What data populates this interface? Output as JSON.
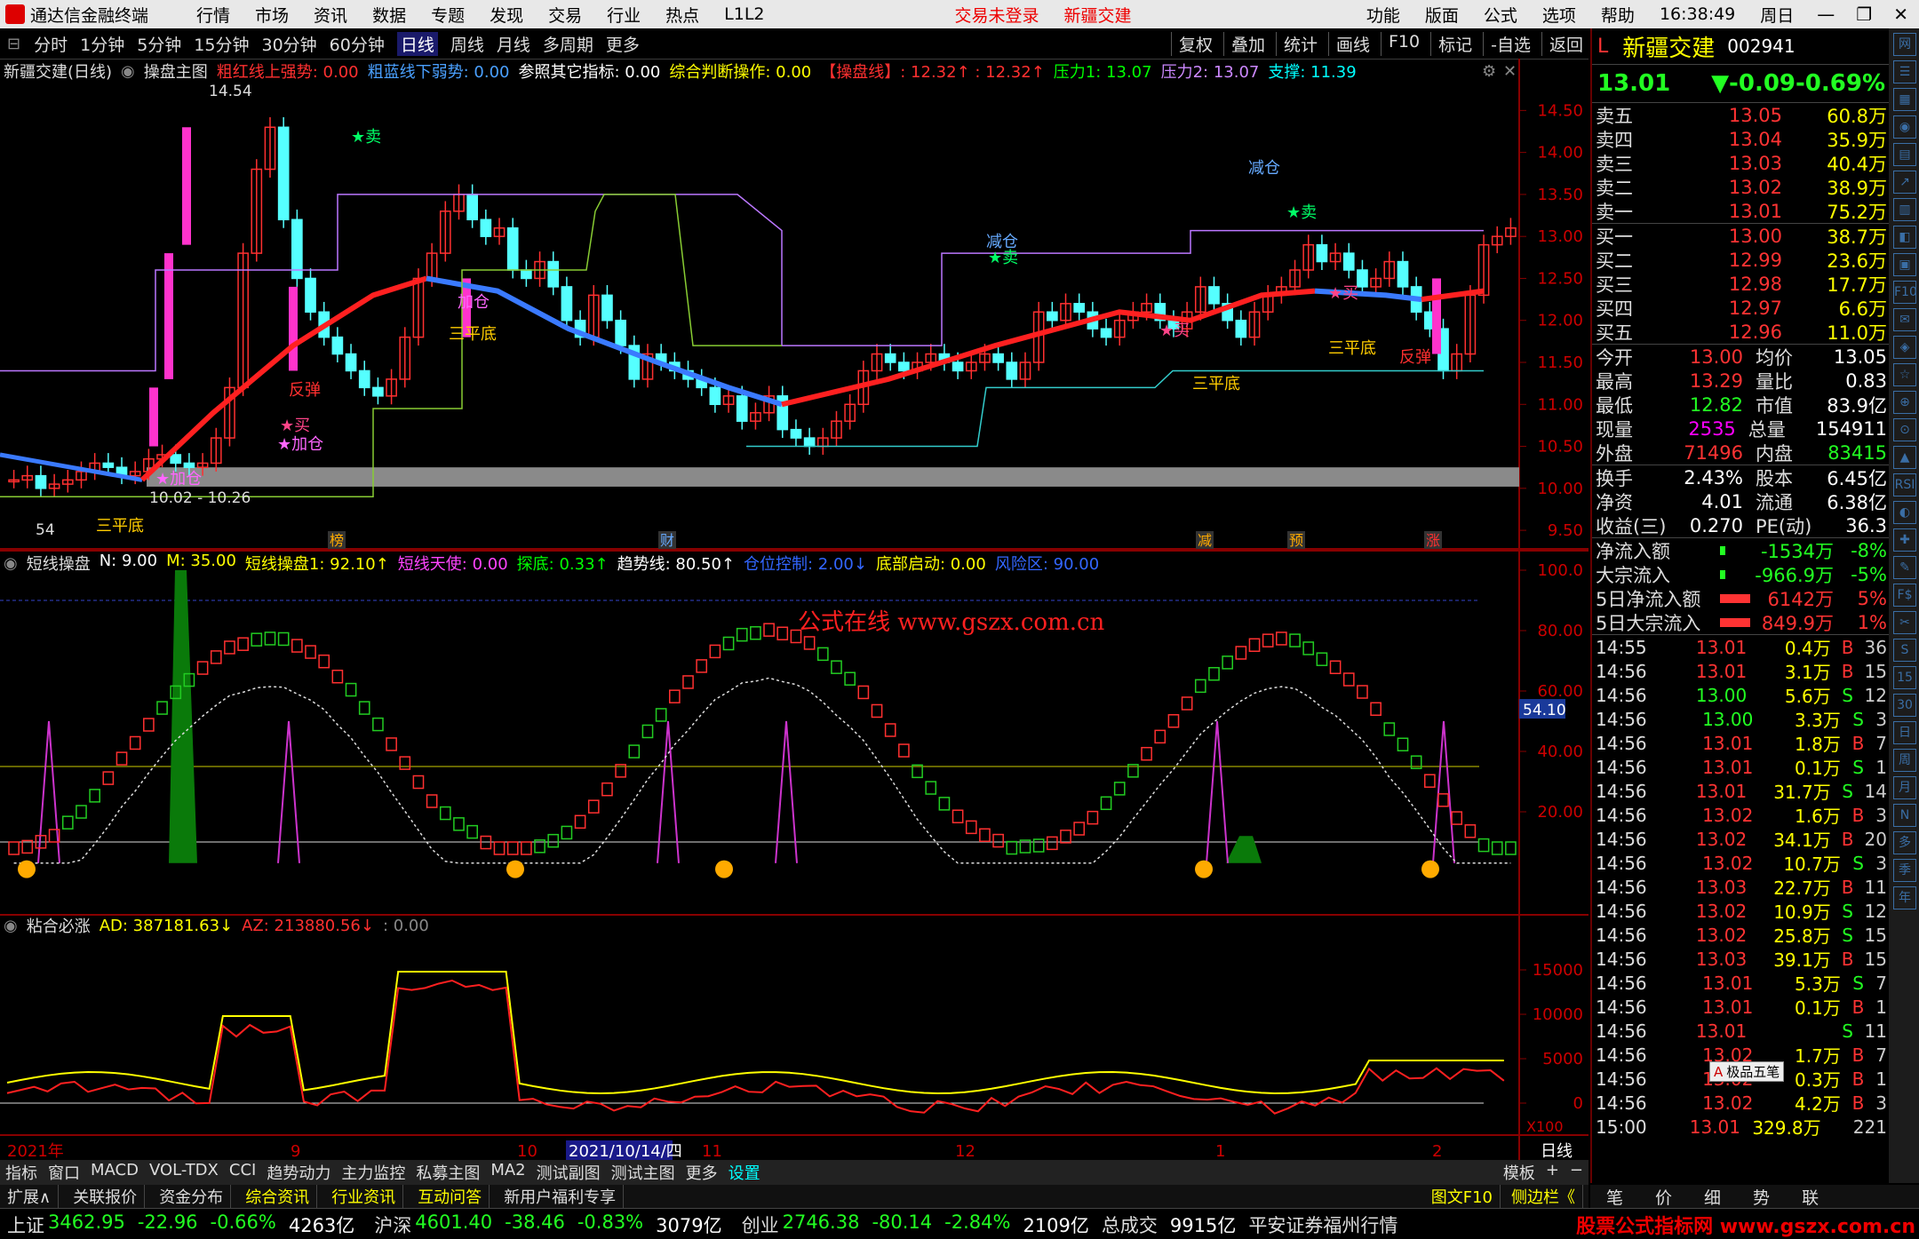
{
  "menu": {
    "app_title": "通达信金融终端",
    "items": [
      "行情",
      "市场",
      "资讯",
      "数据",
      "专题",
      "发现",
      "交易",
      "行业",
      "热点",
      "L1L2"
    ],
    "login_status": "交易未登录",
    "stock_tag": "新疆交建",
    "right_items": [
      "功能",
      "版面",
      "公式",
      "选项",
      "帮助"
    ],
    "time": "16:38:49",
    "weekday": "周日"
  },
  "periods": [
    "分时",
    "1分钟",
    "5分钟",
    "15分钟",
    "30分钟",
    "60分钟",
    "日线",
    "周线",
    "月线",
    "多周期",
    "更多"
  ],
  "active_period": "日线",
  "toolbar": [
    "复权",
    "叠加",
    "统计",
    "画线",
    "F10",
    "标记",
    "-自选",
    "返回"
  ],
  "main": {
    "title": "新疆交建(日线)",
    "indicator": "操盘主图",
    "params": [
      {
        "t": "粗红线上强势: 0.00",
        "c": "#ff3030"
      },
      {
        "t": "粗蓝线下弱势: 0.00",
        "c": "#4aa0ff"
      },
      {
        "t": "参照其它指标: 0.00",
        "c": "#ffffff"
      },
      {
        "t": "综合判断操作: 0.00",
        "c": "#ffff00"
      },
      {
        "t": "【操盘线】: 12.32↑ : 12.32↑",
        "c": "#ff3030"
      },
      {
        "t": "压力1: 13.07",
        "c": "#00ff00"
      },
      {
        "t": "压力2: 13.07",
        "c": "#cc88ff"
      },
      {
        "t": "支撑: 11.39",
        "c": "#00ffff"
      }
    ],
    "yticks": [
      "14.50",
      "14.00",
      "13.50",
      "13.00",
      "12.50",
      "12.00",
      "11.50",
      "11.00",
      "10.50",
      "10.00",
      "9.50"
    ],
    "yrange": [
      9.3,
      14.8
    ],
    "high_label": "14.54",
    "low_label": "54",
    "range_label": "10.02 - 10.26",
    "annotations": [
      {
        "t": "★卖",
        "c": "#00ff66",
        "x": 395,
        "y": 160
      },
      {
        "t": "反弹",
        "c": "#ff3030",
        "x": 325,
        "y": 445
      },
      {
        "t": "★买",
        "c": "#ff4488",
        "x": 315,
        "y": 485
      },
      {
        "t": "★加仓",
        "c": "#ff66ff",
        "x": 312,
        "y": 506
      },
      {
        "t": "★加仓",
        "c": "#ff66ff",
        "x": 175,
        "y": 545
      },
      {
        "t": "加仓",
        "c": "#ff66ff",
        "x": 515,
        "y": 346
      },
      {
        "t": "三平底",
        "c": "#ffcc00",
        "x": 505,
        "y": 382
      },
      {
        "t": "减仓",
        "c": "#66aaff",
        "x": 1110,
        "y": 278
      },
      {
        "t": "★卖",
        "c": "#00ff66",
        "x": 1112,
        "y": 296
      },
      {
        "t": "减仓",
        "c": "#66aaff",
        "x": 1405,
        "y": 195
      },
      {
        "t": "★卖",
        "c": "#00ff66",
        "x": 1448,
        "y": 245
      },
      {
        "t": "★买",
        "c": "#ff4488",
        "x": 1495,
        "y": 336
      },
      {
        "t": "★买",
        "c": "#ff4488",
        "x": 1305,
        "y": 378
      },
      {
        "t": "三平底",
        "c": "#ffcc00",
        "x": 1342,
        "y": 438
      },
      {
        "t": "三平底",
        "c": "#ffcc00",
        "x": 1495,
        "y": 398
      },
      {
        "t": "反弹",
        "c": "#ff3030",
        "x": 1575,
        "y": 408
      },
      {
        "t": "三平底",
        "c": "#ffcc00",
        "x": 108,
        "y": 598
      }
    ],
    "events": [
      {
        "t": "榜",
        "x": 378
      },
      {
        "t": "财",
        "x": 750
      },
      {
        "t": "减",
        "x": 1355
      },
      {
        "t": "预",
        "x": 1458
      },
      {
        "t": "涨",
        "x": 1612
      }
    ]
  },
  "ind1": {
    "name": "短线操盘",
    "params": [
      {
        "t": "N: 9.00",
        "c": "#ffffff"
      },
      {
        "t": "M: 35.00",
        "c": "#ffff00"
      },
      {
        "t": "短线操盘1: 92.10↑",
        "c": "#ffff00"
      },
      {
        "t": "短线天使: 0.00",
        "c": "#ff44ff"
      },
      {
        "t": "探底: 0.33↑",
        "c": "#00ff00"
      },
      {
        "t": "趋势线: 80.50↑",
        "c": "#ffffff"
      },
      {
        "t": "仓位控制: 2.00↓",
        "c": "#3366ff"
      },
      {
        "t": "底部启动: 0.00",
        "c": "#ffff00"
      },
      {
        "t": "风险区: 90.00",
        "c": "#3366ff"
      }
    ],
    "yticks": [
      "100.0",
      "80.00",
      "60.00",
      "40.00",
      "20.00"
    ],
    "cursor_value": "54.10",
    "watermark": "公式在线  www.gszx.com.cn"
  },
  "ind2": {
    "name": "粘合必涨",
    "params": [
      {
        "t": "AD: 387181.63↓",
        "c": "#ffff00"
      },
      {
        "t": "AZ: 213880.56↓",
        "c": "#ff3030"
      },
      {
        "t": ": 0.00",
        "c": "#888888"
      }
    ],
    "yticks": [
      "15000",
      "10000",
      "5000",
      "0"
    ],
    "scale": "X100"
  },
  "dates": [
    {
      "t": "2021年",
      "x": 8
    },
    {
      "t": "9",
      "x": 327
    },
    {
      "t": "10",
      "x": 582
    },
    {
      "t": "2021/10/14/四",
      "x": 640,
      "sel": true
    },
    {
      "t": "11",
      "x": 790
    },
    {
      "t": "12",
      "x": 1075
    },
    {
      "t": "1",
      "x": 1368
    },
    {
      "t": "2",
      "x": 1612
    }
  ],
  "date_unit": "日线",
  "tabs": [
    "指标",
    "窗口",
    "MACD",
    "VOL-TDX",
    "CCI",
    "趋势动力",
    "主力监控",
    "私募主图",
    "MA2",
    "测试副图",
    "测试主图",
    "更多",
    "设置"
  ],
  "tabs_right": [
    "模板",
    "+",
    "−"
  ],
  "tabs2": [
    "扩展∧",
    "关联报价",
    "资金分布",
    "综合资讯",
    "行业资讯",
    "互动问答",
    "新用户福利专享"
  ],
  "tabs2_right": [
    "图文F10",
    "侧边栏《"
  ],
  "quote": {
    "name": "新疆交建",
    "code": "002941",
    "price": "13.01",
    "change": "▼-0.09",
    "pct": "-0.69%",
    "asks": [
      {
        "l": "卖五",
        "p": "13.05",
        "v": "60.8万"
      },
      {
        "l": "卖四",
        "p": "13.04",
        "v": "35.9万"
      },
      {
        "l": "卖三",
        "p": "13.03",
        "v": "40.4万"
      },
      {
        "l": "卖二",
        "p": "13.02",
        "v": "38.9万"
      },
      {
        "l": "卖一",
        "p": "13.01",
        "v": "75.2万"
      }
    ],
    "bids": [
      {
        "l": "买一",
        "p": "13.00",
        "v": "38.7万"
      },
      {
        "l": "买二",
        "p": "12.99",
        "v": "23.6万"
      },
      {
        "l": "买三",
        "p": "12.98",
        "v": "17.7万"
      },
      {
        "l": "买四",
        "p": "12.97",
        "v": "6.6万"
      },
      {
        "l": "买五",
        "p": "12.96",
        "v": "11.0万"
      }
    ],
    "stats": [
      [
        "今开",
        "13.00",
        "up",
        "均价",
        "13.05",
        "wh"
      ],
      [
        "最高",
        "13.29",
        "up",
        "量比",
        "0.83",
        "wh"
      ],
      [
        "最低",
        "12.82",
        "dn",
        "市值",
        "83.9亿",
        "wh"
      ],
      [
        "现量",
        "2535",
        "mg",
        "总量",
        "154911",
        "wh"
      ],
      [
        "外盘",
        "71496",
        "up",
        "内盘",
        "83415",
        "dn"
      ]
    ],
    "stats2": [
      [
        "换手",
        "2.43%",
        "wh",
        "股本",
        "6.45亿",
        "wh"
      ],
      [
        "净资",
        "4.01",
        "wh",
        "流通",
        "6.38亿",
        "wh"
      ],
      [
        "收益(三)",
        "0.270",
        "wh",
        "PE(动)",
        "36.3",
        "wh"
      ]
    ],
    "flows": [
      {
        "l": "净流入额",
        "v": "-1534万",
        "p": "-8%",
        "c": "dn"
      },
      {
        "l": "大宗流入",
        "v": "-966.9万",
        "p": "-5%",
        "c": "dn"
      },
      {
        "l": "5日净流入额",
        "v": "6142万",
        "p": "5%",
        "c": "up"
      },
      {
        "l": "5日大宗流入",
        "v": "849.9万",
        "p": "1%",
        "c": "up"
      }
    ],
    "ticks": [
      [
        "14:55",
        "13.01",
        "0.4万",
        "B",
        "36"
      ],
      [
        "14:56",
        "13.01",
        "3.1万",
        "B",
        "15"
      ],
      [
        "14:56",
        "13.00",
        "5.6万",
        "S",
        "12"
      ],
      [
        "14:56",
        "13.00",
        "3.3万",
        "S",
        "3"
      ],
      [
        "14:56",
        "13.01",
        "1.8万",
        "B",
        "7"
      ],
      [
        "14:56",
        "13.01",
        "0.1万",
        "S",
        "1"
      ],
      [
        "14:56",
        "13.01",
        "31.7万",
        "S",
        "14"
      ],
      [
        "14:56",
        "13.02",
        "1.6万",
        "B",
        "3"
      ],
      [
        "14:56",
        "13.02",
        "34.1万",
        "B",
        "20"
      ],
      [
        "14:56",
        "13.02",
        "10.7万",
        "S",
        "3"
      ],
      [
        "14:56",
        "13.03",
        "22.7万",
        "B",
        "11"
      ],
      [
        "14:56",
        "13.02",
        "10.9万",
        "S",
        "12"
      ],
      [
        "14:56",
        "13.02",
        "25.8万",
        "S",
        "15"
      ],
      [
        "14:56",
        "13.03",
        "39.1万",
        "B",
        "15"
      ],
      [
        "14:56",
        "13.01",
        "5.3万",
        "S",
        "7"
      ],
      [
        "14:56",
        "13.01",
        "0.1万",
        "B",
        "1"
      ],
      [
        "14:56",
        "13.01",
        "",
        "S",
        "11"
      ],
      [
        "14:56",
        "13.02",
        "1.7万",
        "B",
        "7"
      ],
      [
        "14:56",
        "13.02",
        "0.3万",
        "B",
        "1"
      ],
      [
        "14:56",
        "13.02",
        "4.2万",
        "B",
        "3"
      ],
      [
        "15:00",
        "13.01",
        "329.8万",
        "",
        "221"
      ]
    ],
    "ime": "极品五笔"
  },
  "quote_tabs": [
    "笔",
    "价",
    "细",
    "势",
    "联"
  ],
  "sidebar": [
    "网",
    "☰",
    "▦",
    "◉",
    "▤",
    "↗",
    "▥",
    "◧",
    "▣",
    "F10",
    "✉",
    "◈",
    "☆",
    "⊕",
    "⊙",
    "▲",
    "RSI",
    "◐",
    "✚",
    "✎",
    "F$",
    "✂",
    "S",
    "15",
    "30",
    "日",
    "周",
    "月",
    "N",
    "多",
    "季",
    "年"
  ],
  "index": [
    {
      "n": "上证",
      "v": "3462.95",
      "c": "-22.96",
      "p": "-0.66%",
      "a": "4263亿"
    },
    {
      "n": "沪深",
      "v": "4601.40",
      "c": "-38.46",
      "p": "-0.83%",
      "a": "3079亿"
    },
    {
      "n": "创业",
      "v": "2746.38",
      "c": "-80.14",
      "p": "-2.84%",
      "a": "2109亿"
    }
  ],
  "total_label": "总成交",
  "total_value": "9915亿",
  "broker": "平安证券福州行情",
  "watermark2": "股票公式指标网 www.gszx.com.cn",
  "chart_data": {
    "type": "candlestick",
    "series_main": [
      10.1,
      10.15,
      10.0,
      10.05,
      10.1,
      10.2,
      10.3,
      10.25,
      10.15,
      10.2,
      10.35,
      10.4,
      10.3,
      10.25,
      10.3,
      10.6,
      11.2,
      12.8,
      13.8,
      14.3,
      13.2,
      12.5,
      12.1,
      11.8,
      11.6,
      11.4,
      11.2,
      11.1,
      11.3,
      11.8,
      12.5,
      12.8,
      13.3,
      13.5,
      13.2,
      13.0,
      13.1,
      12.6,
      12.5,
      12.7,
      12.4,
      12.0,
      11.8,
      12.3,
      12.0,
      11.7,
      11.3,
      11.6,
      11.5,
      11.4,
      11.3,
      11.2,
      11.0,
      11.1,
      10.8,
      10.9,
      11.1,
      10.7,
      10.6,
      10.5,
      10.6,
      10.8,
      11.0,
      11.4,
      11.6,
      11.5,
      11.4,
      11.5,
      11.6,
      11.5,
      11.4,
      11.5,
      11.6,
      11.5,
      11.3,
      11.5,
      12.1,
      12.0,
      12.2,
      12.1,
      11.9,
      11.8,
      12.0,
      12.1,
      12.2,
      12.0,
      11.9,
      12.1,
      12.4,
      12.2,
      12.0,
      11.8,
      12.1,
      12.3,
      12.4,
      12.6,
      12.9,
      12.7,
      12.8,
      12.6,
      12.4,
      12.5,
      12.7,
      12.4,
      12.1,
      11.9,
      11.4,
      11.6,
      12.3,
      12.9,
      13.0,
      13.1
    ]
  }
}
